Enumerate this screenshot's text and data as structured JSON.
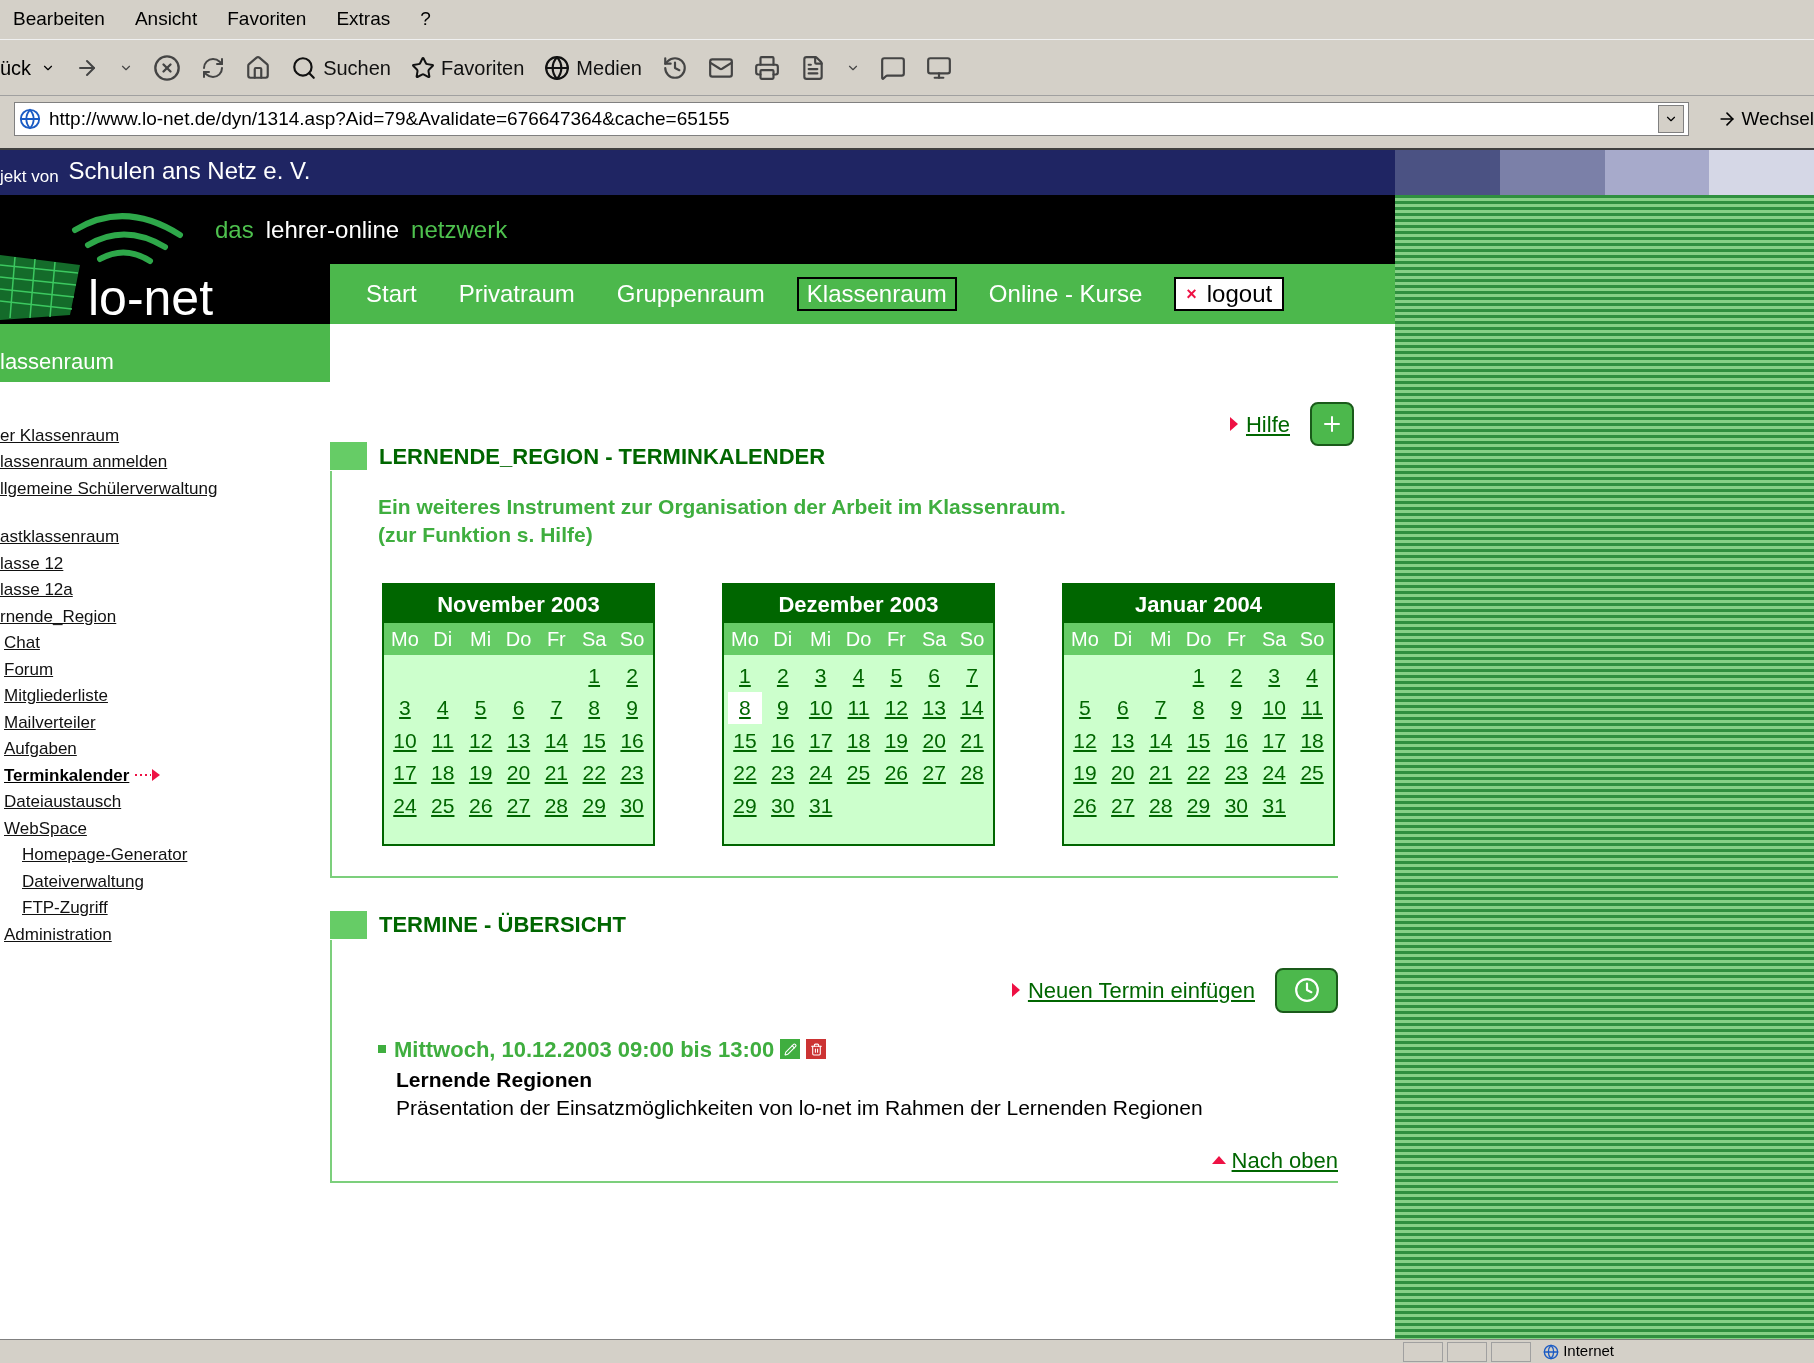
{
  "menu": [
    "Bearbeiten",
    "Ansicht",
    "Favoriten",
    "Extras",
    "?"
  ],
  "toolbar": {
    "back": "ück",
    "buttons": [
      "Suchen",
      "Favoriten",
      "Medien"
    ]
  },
  "address": {
    "value": "http://www.lo-net.de/dyn/1314.asp?Aid=79&Avalidate=676647364&cache=65155",
    "go": "Wechsel"
  },
  "banner": {
    "prefix": "jekt von",
    "org": "Schulen ans Netz e. V."
  },
  "tagline": [
    "das",
    "lehrer-online",
    "netzwerk"
  ],
  "logo": "lo-net",
  "nav": [
    {
      "label": "Start",
      "kind": "tab",
      "selected": false
    },
    {
      "label": "Privatraum",
      "kind": "tab",
      "selected": false
    },
    {
      "label": "Gruppenraum",
      "kind": "tab",
      "selected": false
    },
    {
      "label": "Klassenraum",
      "kind": "tab",
      "selected": true
    },
    {
      "label": "Online - Kurse",
      "kind": "tab",
      "selected": false
    },
    {
      "label": "logout",
      "kind": "logout",
      "icon": "×",
      "selected": false
    }
  ],
  "section_bar": "lassenraum",
  "sidebar": {
    "groups": [
      {
        "items": [
          {
            "label": "er Klassenraum",
            "selected": false
          },
          {
            "label": "lassenraum anmelden",
            "selected": false
          },
          {
            "label": "llgemeine Schülerverwaltung",
            "selected": false
          }
        ]
      },
      {
        "items": [
          {
            "label": "astklassenraum",
            "selected": false
          },
          {
            "label": "lasse 12",
            "selected": false
          },
          {
            "label": "lasse 12a",
            "selected": false
          },
          {
            "label": "rnende_Region",
            "selected": false,
            "children": [
              {
                "label": "Chat",
                "selected": false
              },
              {
                "label": "Forum",
                "selected": false
              },
              {
                "label": "Mitgliederliste",
                "selected": false
              },
              {
                "label": "Mailverteiler",
                "selected": false
              },
              {
                "label": "Aufgaben",
                "selected": false
              },
              {
                "label": "Terminkalender",
                "selected": true
              },
              {
                "label": "Dateiaustausch",
                "selected": false
              },
              {
                "label": "WebSpace",
                "selected": false,
                "children": [
                  {
                    "label": "Homepage-Generator",
                    "selected": false
                  },
                  {
                    "label": "Dateiverwaltung",
                    "selected": false
                  },
                  {
                    "label": "FTP-Zugriff",
                    "selected": false
                  }
                ]
              },
              {
                "label": "Administration",
                "selected": false
              }
            ]
          }
        ]
      }
    ]
  },
  "help": "Hilfe",
  "calendar_section": {
    "title": "LERNENDE_REGION - TERMINKALENDER",
    "intro": [
      "Ein weiteres Instrument zur Organisation der Arbeit im Klassenraum.",
      "(zur Funktion s. Hilfe)"
    ],
    "months": [
      {
        "title": "November 2003",
        "weekdays": [
          "Mo",
          "Di",
          "Mi",
          "Do",
          "Fr",
          "Sa",
          "So"
        ],
        "weeks": [
          {
            "days": [
              {
                "n": "1",
                "selected": false
              },
              {
                "n": "2",
                "selected": false
              }
            ]
          },
          {
            "days": [
              {
                "n": "3",
                "selected": false
              },
              {
                "n": "4",
                "selected": false
              },
              {
                "n": "5",
                "selected": false
              },
              {
                "n": "6",
                "selected": false
              },
              {
                "n": "7",
                "selected": false
              },
              {
                "n": "8",
                "selected": false
              },
              {
                "n": "9",
                "selected": false
              }
            ]
          },
          {
            "days": [
              {
                "n": "10",
                "selected": false
              },
              {
                "n": "11",
                "selected": false
              },
              {
                "n": "12",
                "selected": false
              },
              {
                "n": "13",
                "selected": false
              },
              {
                "n": "14",
                "selected": false
              },
              {
                "n": "15",
                "selected": false
              },
              {
                "n": "16",
                "selected": false
              }
            ]
          },
          {
            "days": [
              {
                "n": "17",
                "selected": false
              },
              {
                "n": "18",
                "selected": false
              },
              {
                "n": "19",
                "selected": false
              },
              {
                "n": "20",
                "selected": false
              },
              {
                "n": "21",
                "selected": false
              },
              {
                "n": "22",
                "selected": false
              },
              {
                "n": "23",
                "selected": false
              }
            ]
          },
          {
            "days": [
              {
                "n": "24",
                "selected": false
              },
              {
                "n": "25",
                "selected": false
              },
              {
                "n": "26",
                "selected": false
              },
              {
                "n": "27",
                "selected": false
              },
              {
                "n": "28",
                "selected": false
              },
              {
                "n": "29",
                "selected": false
              },
              {
                "n": "30",
                "selected": false
              }
            ]
          }
        ]
      },
      {
        "title": "Dezember 2003",
        "weekdays": [
          "Mo",
          "Di",
          "Mi",
          "Do",
          "Fr",
          "Sa",
          "So"
        ],
        "weeks": [
          {
            "days": [
              {
                "n": "1",
                "selected": false
              },
              {
                "n": "2",
                "selected": false
              },
              {
                "n": "3",
                "selected": false
              },
              {
                "n": "4",
                "selected": false
              },
              {
                "n": "5",
                "selected": false
              },
              {
                "n": "6",
                "selected": false
              },
              {
                "n": "7",
                "selected": false
              }
            ]
          },
          {
            "days": [
              {
                "n": "8",
                "selected": true
              },
              {
                "n": "9",
                "selected": false
              },
              {
                "n": "10",
                "selected": false
              },
              {
                "n": "11",
                "selected": false
              },
              {
                "n": "12",
                "selected": false
              },
              {
                "n": "13",
                "selected": false
              },
              {
                "n": "14",
                "selected": false
              }
            ]
          },
          {
            "days": [
              {
                "n": "15",
                "selected": false
              },
              {
                "n": "16",
                "selected": false
              },
              {
                "n": "17",
                "selected": false
              },
              {
                "n": "18",
                "selected": false
              },
              {
                "n": "19",
                "selected": false
              },
              {
                "n": "20",
                "selected": false
              },
              {
                "n": "21",
                "selected": false
              }
            ]
          },
          {
            "days": [
              {
                "n": "22",
                "selected": false
              },
              {
                "n": "23",
                "selected": false
              },
              {
                "n": "24",
                "selected": false
              },
              {
                "n": "25",
                "selected": false
              },
              {
                "n": "26",
                "selected": false
              },
              {
                "n": "27",
                "selected": false
              },
              {
                "n": "28",
                "selected": false
              }
            ]
          },
          {
            "days": [
              {
                "n": "29",
                "selected": false
              },
              {
                "n": "30",
                "selected": false
              },
              {
                "n": "31",
                "selected": false
              }
            ]
          }
        ]
      },
      {
        "title": "Januar 2004",
        "weekdays": [
          "Mo",
          "Di",
          "Mi",
          "Do",
          "Fr",
          "Sa",
          "So"
        ],
        "weeks": [
          {
            "days": [
              {
                "n": "1",
                "selected": false
              },
              {
                "n": "2",
                "selected": false
              },
              {
                "n": "3",
                "selected": false
              },
              {
                "n": "4",
                "selected": false
              }
            ]
          },
          {
            "days": [
              {
                "n": "5",
                "selected": false
              },
              {
                "n": "6",
                "selected": false
              },
              {
                "n": "7",
                "selected": false
              },
              {
                "n": "8",
                "selected": false
              },
              {
                "n": "9",
                "selected": false
              },
              {
                "n": "10",
                "selected": false
              },
              {
                "n": "11",
                "selected": false
              }
            ]
          },
          {
            "days": [
              {
                "n": "12",
                "selected": false
              },
              {
                "n": "13",
                "selected": false
              },
              {
                "n": "14",
                "selected": false
              },
              {
                "n": "15",
                "selected": false
              },
              {
                "n": "16",
                "selected": false
              },
              {
                "n": "17",
                "selected": false
              },
              {
                "n": "18",
                "selected": false
              }
            ]
          },
          {
            "days": [
              {
                "n": "19",
                "selected": false
              },
              {
                "n": "20",
                "selected": false
              },
              {
                "n": "21",
                "selected": false
              },
              {
                "n": "22",
                "selected": false
              },
              {
                "n": "23",
                "selected": false
              },
              {
                "n": "24",
                "selected": false
              },
              {
                "n": "25",
                "selected": false
              }
            ]
          },
          {
            "days": [
              {
                "n": "26",
                "selected": false
              },
              {
                "n": "27",
                "selected": false
              },
              {
                "n": "28",
                "selected": false
              },
              {
                "n": "29",
                "selected": false
              },
              {
                "n": "30",
                "selected": false
              },
              {
                "n": "31",
                "selected": false
              }
            ]
          }
        ]
      }
    ]
  },
  "events_section": {
    "title": "TERMINE - ÜBERSICHT",
    "add_link": "Neuen Termin einfügen",
    "events": [
      {
        "when": "Mittwoch, 10.12.2003 09:00 bis 13:00",
        "title": "Lernende Regionen",
        "description": "Präsentation der Einsatzmöglichkeiten von lo-net im Rahmen der Lernenden Regionen"
      }
    ],
    "top_link": "Nach oben"
  },
  "status_bar": {
    "zone": "Internet"
  }
}
